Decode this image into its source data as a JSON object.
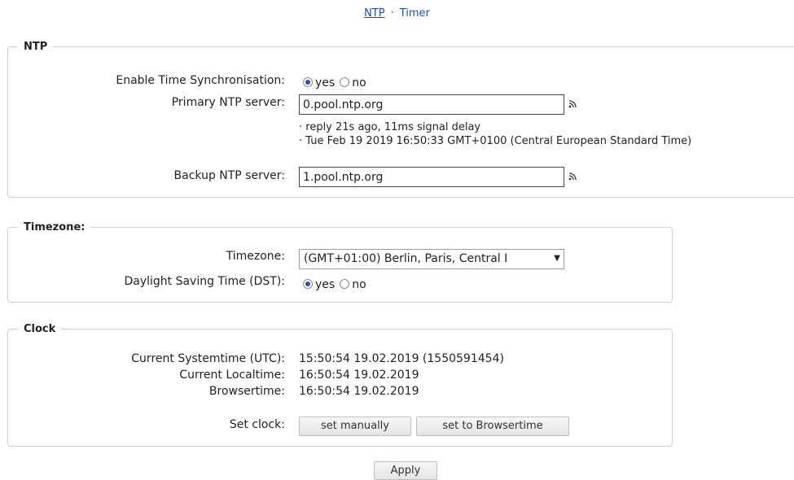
{
  "nav": {
    "ntp_link": "NTP",
    "separator": "·",
    "timer_link": "Timer"
  },
  "ntp": {
    "legend": "NTP",
    "enable_label": "Enable Time Synchronisation:",
    "enable_yes": "yes",
    "enable_no": "no",
    "enable_selected": "yes",
    "primary_label": "Primary NTP server:",
    "primary_value": "0.pool.ntp.org",
    "primary_info_1": "· reply 21s ago, 11ms signal delay",
    "primary_info_2": "· Tue Feb 19 2019 16:50:33 GMT+0100 (Central European Standard Time)",
    "backup_label": "Backup NTP server:",
    "backup_value": "1.pool.ntp.org",
    "feed_icon": "rss-icon"
  },
  "timezone": {
    "legend": "Timezone:",
    "tz_label": "Timezone:",
    "tz_value": "(GMT+01:00) Berlin, Paris, Central I",
    "dst_label": "Daylight Saving Time (DST):",
    "dst_yes": "yes",
    "dst_no": "no",
    "dst_selected": "yes"
  },
  "clock": {
    "legend": "Clock",
    "systemtime_label": "Current Systemtime (UTC):",
    "systemtime_value": "15:50:54 19.02.2019 (1550591454)",
    "localtime_label": "Current Localtime:",
    "localtime_value": "16:50:54 19.02.2019",
    "browsertime_label": "Browsertime:",
    "browsertime_value": "16:50:54 19.02.2019",
    "setclock_label": "Set clock:",
    "set_manually": "set manually",
    "set_browsertime": "set to Browsertime"
  },
  "apply_label": "Apply",
  "colors": {
    "link": "#1a4fb0",
    "radio_selected": "#2a4fb0",
    "border": "#cfcfcf"
  }
}
